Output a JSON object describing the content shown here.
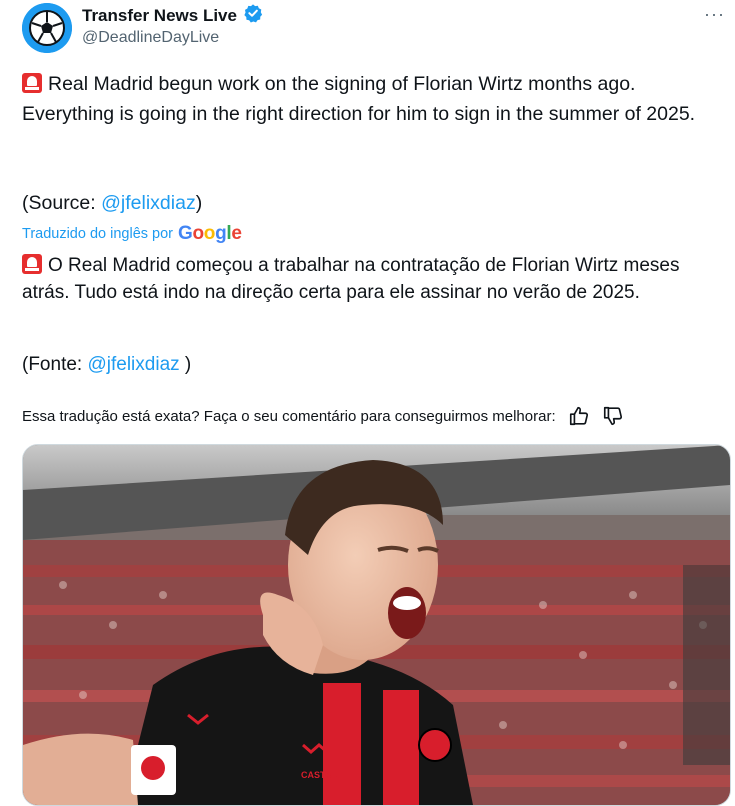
{
  "author": {
    "display_name": "Transfer News Live",
    "handle": "@DeadlineDayLive",
    "verified": true
  },
  "more_label": "···",
  "original": {
    "text": "Real Madrid begun work on the signing of Florian Wirtz months ago. Everything is going in the right direction for him to sign in the summer of 2025.",
    "source_prefix": "(Source: ",
    "source_link": "@jfelixdiaz",
    "source_suffix": ")"
  },
  "translation": {
    "label": "Traduzido do inglês por",
    "provider": "Google",
    "text": "O Real Madrid começou a trabalhar na contratação de Florian Wirtz meses atrás. Tudo está indo na direção certa para ele assinar no verão de 2025.",
    "source_prefix": "(Fonte: ",
    "source_link": "@jfelixdiaz",
    "source_suffix": " )"
  },
  "feedback": {
    "text": "Essa tradução está exata? Faça o seu comentário para conseguirmos melhorar:"
  },
  "colors": {
    "accent": "#1d9bf0",
    "secondary_text": "#536471",
    "jersey_red": "#d81e2c",
    "jersey_black": "#151515"
  },
  "media": {
    "jersey_text": "CASTORE"
  }
}
